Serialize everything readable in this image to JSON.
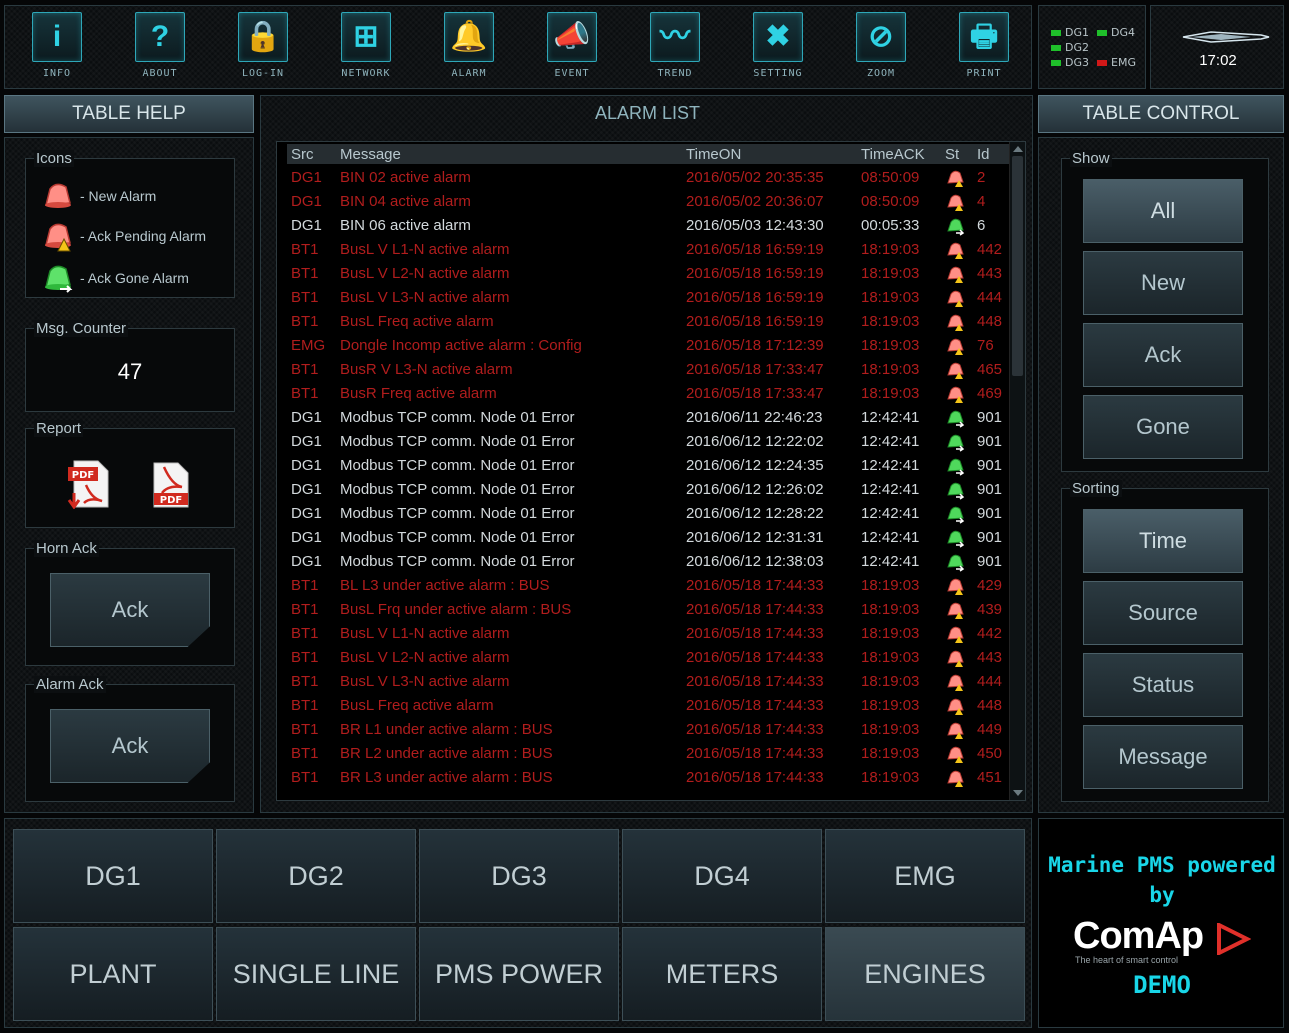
{
  "toolbar": {
    "items": [
      {
        "label": "INFO",
        "icon": "info-icon",
        "glyph": "i"
      },
      {
        "label": "ABOUT",
        "icon": "help-icon",
        "glyph": "?"
      },
      {
        "label": "LOG-IN",
        "icon": "lock-icon",
        "glyph": "🔒"
      },
      {
        "label": "NETWORK",
        "icon": "network-icon",
        "glyph": "⊞"
      },
      {
        "label": "ALARM",
        "icon": "bell-icon",
        "glyph": "🔔"
      },
      {
        "label": "EVENT",
        "icon": "whistle-icon",
        "glyph": "📣"
      },
      {
        "label": "TREND",
        "icon": "trend-icon",
        "glyph": "〰"
      },
      {
        "label": "SETTING",
        "icon": "tools-icon",
        "glyph": "✖"
      },
      {
        "label": "ZOOM",
        "icon": "zoom-icon",
        "glyph": "⊘"
      },
      {
        "label": "PRINT",
        "icon": "printer-icon",
        "glyph": "🖶"
      }
    ]
  },
  "gen_status": [
    {
      "label": "DG1",
      "color": "#1fbf2a"
    },
    {
      "label": "DG4",
      "color": "#1fbf2a"
    },
    {
      "label": "DG2",
      "color": "#1fbf2a"
    },
    {
      "label": "DG3",
      "color": "#1fbf2a"
    },
    {
      "label": "EMG",
      "color": "#d01818"
    }
  ],
  "clock": {
    "time": "17:02"
  },
  "table_help": {
    "title": "TABLE HELP",
    "icons_title": "Icons",
    "legend": [
      {
        "label": "- New Alarm",
        "icon": "new-alarm-bell-icon"
      },
      {
        "label": "- Ack Pending Alarm",
        "icon": "ack-pending-bell-icon"
      },
      {
        "label": "- Ack Gone Alarm",
        "icon": "ack-gone-bell-icon"
      }
    ],
    "counter_title": "Msg. Counter",
    "counter_value": "47",
    "report_title": "Report",
    "horn_title": "Horn Ack",
    "horn_button": "Ack",
    "alarm_ack_title": "Alarm Ack",
    "alarm_ack_button": "Ack"
  },
  "alarm_list": {
    "title": "ALARM LIST",
    "columns": [
      "Src",
      "Message",
      "TimeON",
      "TimeACK",
      "St",
      "Id"
    ],
    "rows": [
      {
        "src": "DG1",
        "msg": "BIN 02 active alarm",
        "on": "2016/05/02 20:35:35",
        "ack": "08:50:09",
        "st": "pending",
        "id": "2",
        "color": "red"
      },
      {
        "src": "DG1",
        "msg": "BIN 04 active alarm",
        "on": "2016/05/02 20:36:07",
        "ack": "08:50:09",
        "st": "pending",
        "id": "4",
        "color": "red"
      },
      {
        "src": "DG1",
        "msg": "BIN 06 active alarm",
        "on": "2016/05/03 12:43:30",
        "ack": "00:05:33",
        "st": "gone",
        "id": "6",
        "color": "white"
      },
      {
        "src": "BT1",
        "msg": "BusL V L1-N active alarm",
        "on": "2016/05/18 16:59:19",
        "ack": "18:19:03",
        "st": "pending",
        "id": "442",
        "color": "red"
      },
      {
        "src": "BT1",
        "msg": "BusL V L2-N active alarm",
        "on": "2016/05/18 16:59:19",
        "ack": "18:19:03",
        "st": "pending",
        "id": "443",
        "color": "red"
      },
      {
        "src": "BT1",
        "msg": "BusL V L3-N active alarm",
        "on": "2016/05/18 16:59:19",
        "ack": "18:19:03",
        "st": "pending",
        "id": "444",
        "color": "red"
      },
      {
        "src": "BT1",
        "msg": "BusL Freq active alarm",
        "on": "2016/05/18 16:59:19",
        "ack": "18:19:03",
        "st": "pending",
        "id": "448",
        "color": "red"
      },
      {
        "src": "EMG",
        "msg": "Dongle Incomp active alarm : Config",
        "on": "2016/05/18 17:12:39",
        "ack": "18:19:03",
        "st": "pending",
        "id": "76",
        "color": "red"
      },
      {
        "src": "BT1",
        "msg": "BusR V L3-N active alarm",
        "on": "2016/05/18 17:33:47",
        "ack": "18:19:03",
        "st": "pending",
        "id": "465",
        "color": "red"
      },
      {
        "src": "BT1",
        "msg": "BusR Freq active alarm",
        "on": "2016/05/18 17:33:47",
        "ack": "18:19:03",
        "st": "pending",
        "id": "469",
        "color": "red"
      },
      {
        "src": "DG1",
        "msg": "Modbus TCP comm. Node 01  Error",
        "on": "2016/06/11 22:46:23",
        "ack": "12:42:41",
        "st": "gone",
        "id": "901",
        "color": "white"
      },
      {
        "src": "DG1",
        "msg": "Modbus TCP comm. Node 01  Error",
        "on": "2016/06/12 12:22:02",
        "ack": "12:42:41",
        "st": "gone",
        "id": "901",
        "color": "white"
      },
      {
        "src": "DG1",
        "msg": "Modbus TCP comm. Node 01  Error",
        "on": "2016/06/12 12:24:35",
        "ack": "12:42:41",
        "st": "gone",
        "id": "901",
        "color": "white"
      },
      {
        "src": "DG1",
        "msg": "Modbus TCP comm. Node 01  Error",
        "on": "2016/06/12 12:26:02",
        "ack": "12:42:41",
        "st": "gone",
        "id": "901",
        "color": "white"
      },
      {
        "src": "DG1",
        "msg": "Modbus TCP comm. Node 01  Error",
        "on": "2016/06/12 12:28:22",
        "ack": "12:42:41",
        "st": "gone",
        "id": "901",
        "color": "white"
      },
      {
        "src": "DG1",
        "msg": "Modbus TCP comm. Node 01  Error",
        "on": "2016/06/12 12:31:31",
        "ack": "12:42:41",
        "st": "gone",
        "id": "901",
        "color": "white"
      },
      {
        "src": "DG1",
        "msg": "Modbus TCP comm. Node 01  Error",
        "on": "2016/06/12 12:38:03",
        "ack": "12:42:41",
        "st": "gone",
        "id": "901",
        "color": "white"
      },
      {
        "src": "BT1",
        "msg": "BL L3 under active alarm : BUS",
        "on": "2016/05/18 17:44:33",
        "ack": "18:19:03",
        "st": "pending",
        "id": "429",
        "color": "red"
      },
      {
        "src": "BT1",
        "msg": "BusL Frq under active alarm : BUS",
        "on": "2016/05/18 17:44:33",
        "ack": "18:19:03",
        "st": "pending",
        "id": "439",
        "color": "red"
      },
      {
        "src": "BT1",
        "msg": "BusL V L1-N active alarm",
        "on": "2016/05/18 17:44:33",
        "ack": "18:19:03",
        "st": "pending",
        "id": "442",
        "color": "red"
      },
      {
        "src": "BT1",
        "msg": "BusL V L2-N active alarm",
        "on": "2016/05/18 17:44:33",
        "ack": "18:19:03",
        "st": "pending",
        "id": "443",
        "color": "red"
      },
      {
        "src": "BT1",
        "msg": "BusL V L3-N active alarm",
        "on": "2016/05/18 17:44:33",
        "ack": "18:19:03",
        "st": "pending",
        "id": "444",
        "color": "red"
      },
      {
        "src": "BT1",
        "msg": "BusL Freq active alarm",
        "on": "2016/05/18 17:44:33",
        "ack": "18:19:03",
        "st": "pending",
        "id": "448",
        "color": "red"
      },
      {
        "src": "BT1",
        "msg": "BR L1 under active alarm : BUS",
        "on": "2016/05/18 17:44:33",
        "ack": "18:19:03",
        "st": "pending",
        "id": "449",
        "color": "red"
      },
      {
        "src": "BT1",
        "msg": "BR L2 under active alarm : BUS",
        "on": "2016/05/18 17:44:33",
        "ack": "18:19:03",
        "st": "pending",
        "id": "450",
        "color": "red"
      },
      {
        "src": "BT1",
        "msg": "BR L3 under active alarm : BUS",
        "on": "2016/05/18 17:44:33",
        "ack": "18:19:03",
        "st": "pending",
        "id": "451",
        "color": "red"
      }
    ]
  },
  "table_control": {
    "title": "TABLE CONTROL",
    "show_title": "Show",
    "show_buttons": [
      "All",
      "New",
      "Ack",
      "Gone"
    ],
    "sorting_title": "Sorting",
    "sort_buttons": [
      "Time",
      "Source",
      "Status",
      "Message"
    ]
  },
  "nav": {
    "row1": [
      "DG1",
      "DG2",
      "DG3",
      "DG4",
      "EMG"
    ],
    "row2": [
      "PLANT",
      "SINGLE LINE",
      "PMS POWER",
      "METERS",
      "ENGINES"
    ]
  },
  "brand": {
    "line1": "Marine PMS powered",
    "line2": "by",
    "name": "ComAp",
    "tagline": "The heart of smart control",
    "demo": "DEMO"
  },
  "colors": {
    "accent": "#19d6e8",
    "alarm_red": "#b11d1d",
    "ok_green": "#1fbf2a"
  }
}
